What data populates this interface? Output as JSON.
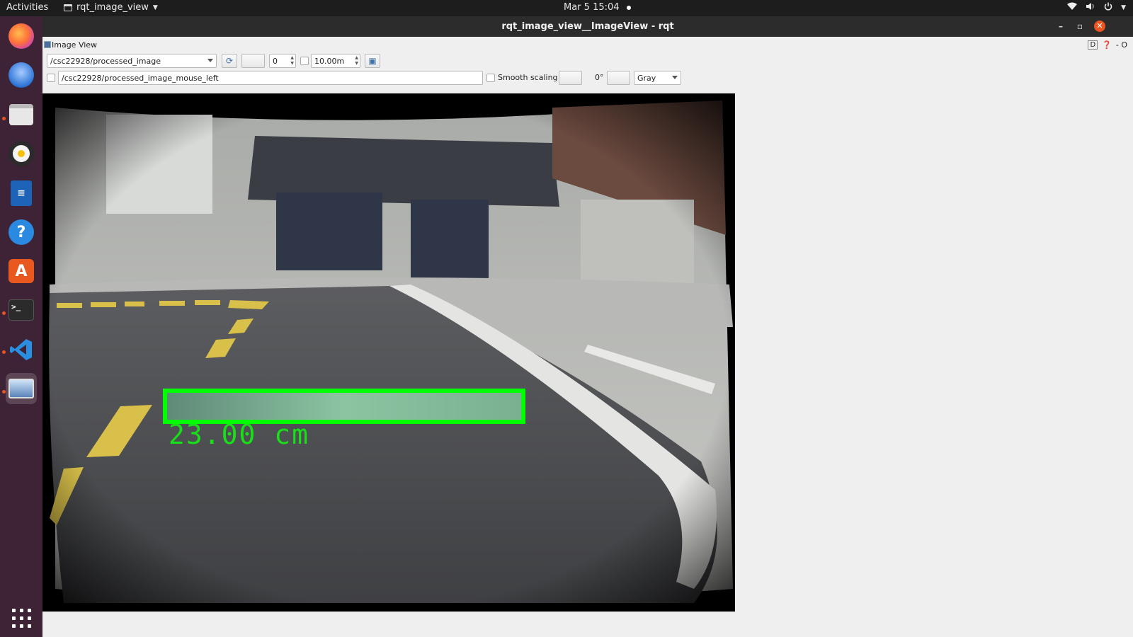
{
  "topbar": {
    "activities": "Activities",
    "app_name": "rqt_image_view",
    "clock": "Mar 5  15:04"
  },
  "dock": {
    "items": [
      "firefox-icon",
      "thunderbird-icon",
      "files-icon",
      "rhythmbox-icon",
      "writer-icon",
      "help-icon",
      "app-store-icon",
      "terminal-icon",
      "vscode-icon",
      "image-view-icon"
    ],
    "accent": "#e95420"
  },
  "window": {
    "title": "rqt_image_view__ImageView - rqt"
  },
  "plugin": {
    "title": "Image View",
    "help_label": "D",
    "right_controls": "- O"
  },
  "toolbar": {
    "topic": "/csc22928/processed_image",
    "num_value": "0",
    "max_range": "10.00m",
    "mouse_topic": "/csc22928/processed_image_mouse_left",
    "smooth_scaling_label": "Smooth scaling",
    "rotation": "0°",
    "color_scheme": "Gray"
  },
  "image": {
    "detection_label": "23.00 cm",
    "box_color": "#00ff00"
  }
}
